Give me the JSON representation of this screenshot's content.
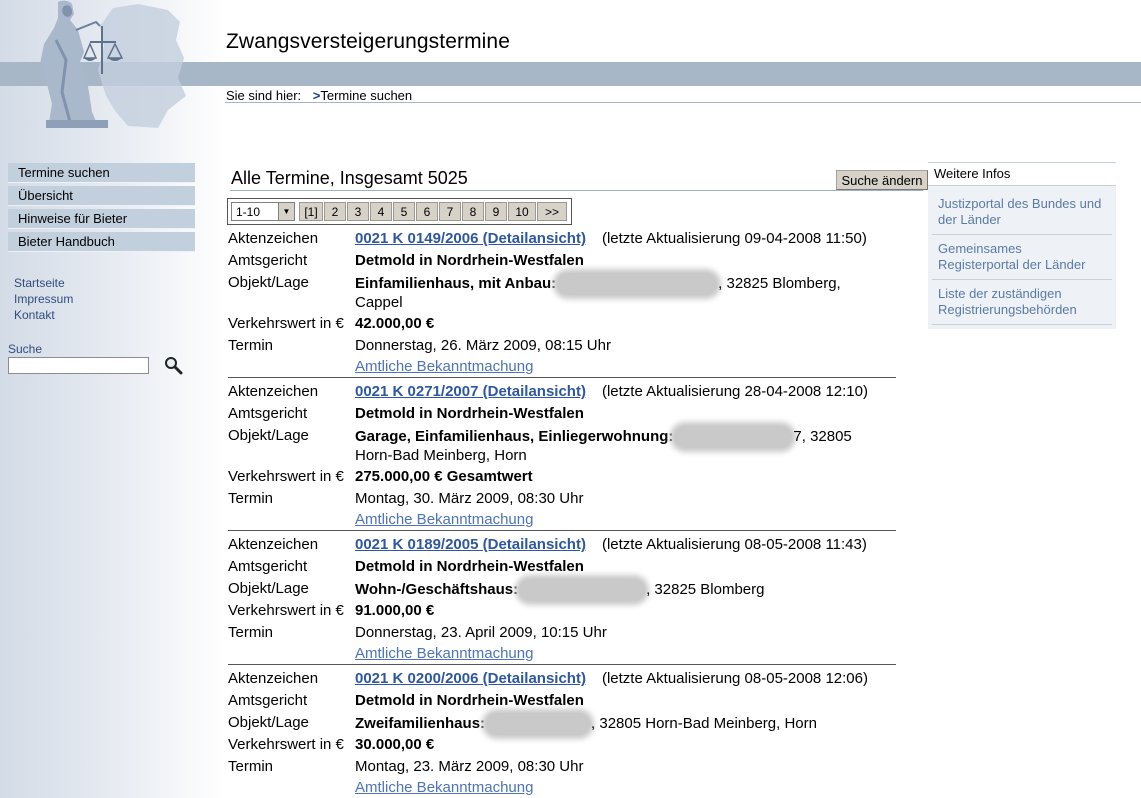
{
  "header": {
    "title": "Zwangsversteigerungstermine",
    "breadcrumb_prefix": "Sie sind hier:",
    "breadcrumb_arrow": ">",
    "breadcrumb_current": "Termine suchen"
  },
  "sidebar": {
    "nav": [
      {
        "label": "Termine suchen"
      },
      {
        "label": "Übersicht"
      },
      {
        "label": "Hinweise für Bieter"
      },
      {
        "label": "Bieter Handbuch"
      }
    ],
    "links": [
      {
        "label": "Startseite"
      },
      {
        "label": "Impressum"
      },
      {
        "label": "Kontakt"
      }
    ],
    "search": {
      "label": "Suche",
      "value": "",
      "icon": "magnifier-icon"
    }
  },
  "main": {
    "heading": "Alle Termine, Insgesamt 5025",
    "change_button": "Suche ändern",
    "pager": {
      "select_value": "1-10",
      "pages": [
        "[1]",
        "2",
        "3",
        "4",
        "5",
        "6",
        "7",
        "8",
        "9",
        "10",
        ">>"
      ]
    },
    "labels": {
      "case": "Aktenzeichen",
      "court": "Amtsgericht",
      "object": "Objekt/Lage",
      "value": "Verkehrswert in €",
      "date": "Termin"
    },
    "records": [
      {
        "case": "0021 K 0149/2006 (Detailansicht)",
        "updated": "(letzte Aktualisierung 09-04-2008 11:50)",
        "court": "Detmold in Nordrhein-Westfalen",
        "object_type": "Einfamilienhaus, mit Anbau:",
        "location_a": ", 32825 Blomberg,",
        "location_b": "Cappel",
        "value": "42.000,00 €",
        "value_suffix": "",
        "date": "Donnerstag, 26. März 2009, 08:15 Uhr",
        "notice": "Amtliche Bekanntmachung"
      },
      {
        "case": "0021 K 0271/2007 (Detailansicht)",
        "updated": "(letzte Aktualisierung 28-04-2008 12:10)",
        "court": "Detmold in Nordrhein-Westfalen",
        "object_type": "Garage, Einfamilienhaus, Einliegerwohnung:",
        "location_a": "7, 32805",
        "location_b": "Horn-Bad Meinberg, Horn",
        "value": "275.000,00 €",
        "value_suffix": "Gesamtwert",
        "date": "Montag, 30. März 2009, 08:30 Uhr",
        "notice": "Amtliche Bekanntmachung"
      },
      {
        "case": "0021 K 0189/2005 (Detailansicht)",
        "updated": "(letzte Aktualisierung 08-05-2008 11:43)",
        "court": "Detmold in Nordrhein-Westfalen",
        "object_type": "Wohn-/Geschäftshaus:",
        "location_a": ", 32825 Blomberg",
        "location_b": "",
        "value": "91.000,00 €",
        "value_suffix": "",
        "date": "Donnerstag, 23. April 2009, 10:15 Uhr",
        "notice": "Amtliche Bekanntmachung"
      },
      {
        "case": "0021 K 0200/2006 (Detailansicht)",
        "updated": "(letzte Aktualisierung 08-05-2008 12:06)",
        "court": "Detmold in Nordrhein-Westfalen",
        "object_type": "Zweifamilienhaus:",
        "location_a": ", 32805 Horn-Bad Meinberg, Horn",
        "location_b": "",
        "value": "30.000,00 €",
        "value_suffix": "",
        "date": "Montag, 23. März 2009, 08:30 Uhr",
        "notice": "Amtliche Bekanntmachung"
      }
    ]
  },
  "right_panel": {
    "heading": "Weitere Infos",
    "items": [
      {
        "label": "Justizportal des Bundes und der Länder"
      },
      {
        "label": "Gemeinsames Registerportal der Länder"
      },
      {
        "label": "Liste der zuständigen Registrierungsbehörden"
      }
    ]
  }
}
